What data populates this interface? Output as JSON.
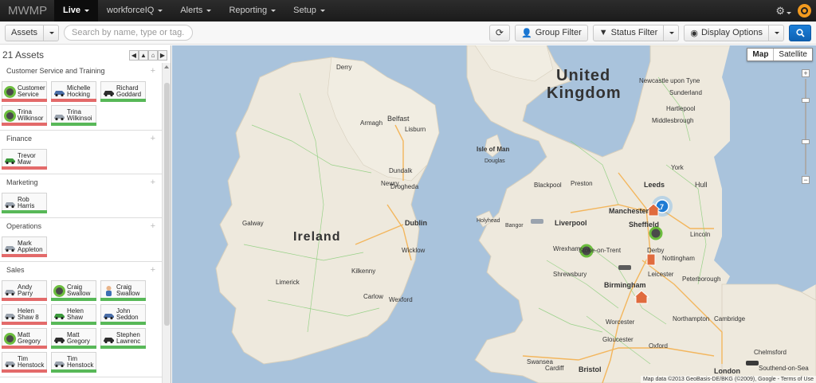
{
  "navbar": {
    "brand": "MWMP",
    "items": [
      {
        "label": "Live",
        "active": true
      },
      {
        "label": "workforceIQ",
        "active": false
      },
      {
        "label": "Alerts",
        "active": false
      },
      {
        "label": "Reporting",
        "active": false
      },
      {
        "label": "Setup",
        "active": false
      }
    ],
    "gear_icon": "gear-icon",
    "user_icon": "user-badge-icon"
  },
  "toolbar": {
    "assets_label": "Assets",
    "search_placeholder": "Search by name, type or tag...",
    "refresh_icon": "refresh-icon",
    "group_filter_label": "Group Filter",
    "status_filter_label": "Status Filter",
    "display_options_label": "Display Options",
    "search_icon": "search-icon"
  },
  "sidebar": {
    "title": "21 Assets",
    "groups": [
      {
        "name": "Customer Service and Training",
        "assets": [
          {
            "name": "Customer Service",
            "line1": "Customer",
            "line2": "Service",
            "icon": "person-dot",
            "status": "red"
          },
          {
            "name": "Michelle Hocking",
            "line1": "Michelle",
            "line2": "Hocking",
            "icon": "car-blue",
            "status": "red"
          },
          {
            "name": "Richard Goddard",
            "line1": "Richard",
            "line2": "Goddard",
            "icon": "car-black",
            "status": "green"
          },
          {
            "name": "Trina Wilkinson",
            "line1": "Trina",
            "line2": "Wilkinsor",
            "icon": "person-dot",
            "status": "red"
          },
          {
            "name": "Trina Wilkinson",
            "line1": "Trina",
            "line2": "Wilkinsoi",
            "icon": "car-silver",
            "status": "green"
          }
        ]
      },
      {
        "name": "Finance",
        "assets": [
          {
            "name": "Trevor Maw",
            "line1": "Trevor",
            "line2": "Maw",
            "icon": "car-green",
            "status": "red"
          }
        ]
      },
      {
        "name": "Marketing",
        "assets": [
          {
            "name": "Rob Harris",
            "line1": "Rob",
            "line2": "Harris",
            "icon": "car-silver",
            "status": "green"
          }
        ]
      },
      {
        "name": "Operations",
        "assets": [
          {
            "name": "Mark Appleton",
            "line1": "Mark",
            "line2": "Appleton",
            "icon": "car-silver",
            "status": "red"
          }
        ]
      },
      {
        "name": "Sales",
        "assets": [
          {
            "name": "Andy Parry",
            "line1": "Andy",
            "line2": "Parry",
            "icon": "car-silver",
            "status": "red"
          },
          {
            "name": "Craig Swallow",
            "line1": "Craig",
            "line2": "Swallow",
            "icon": "person-dot",
            "status": "green"
          },
          {
            "name": "Craig Swallow",
            "line1": "Craig",
            "line2": "Swallow",
            "icon": "person",
            "status": "green"
          },
          {
            "name": "Helen Shaw",
            "line1": "Helen",
            "line2": "Shaw 8",
            "icon": "car-silver",
            "status": "red"
          },
          {
            "name": "Helen Shaw",
            "line1": "Helen",
            "line2": "Shaw",
            "icon": "car-green",
            "status": "green"
          },
          {
            "name": "John Seddon",
            "line1": "John",
            "line2": "Seddon",
            "icon": "car-blue",
            "status": "green"
          },
          {
            "name": "Matt Gregory",
            "line1": "Matt",
            "line2": "Gregory",
            "icon": "person-dot",
            "status": "red"
          },
          {
            "name": "Matt Gregory",
            "line1": "Matt",
            "line2": "Gregory",
            "icon": "car-black",
            "status": "green"
          },
          {
            "name": "Stephen Lawrence",
            "line1": "Stephen",
            "line2": "Lawrenc",
            "icon": "car-black",
            "status": "green"
          },
          {
            "name": "Tim Henstock",
            "line1": "Tim",
            "line2": "Henstock",
            "icon": "car-silver",
            "status": "red"
          },
          {
            "name": "Tim Henstock",
            "line1": "Tim",
            "line2": "Henstock",
            "icon": "car-silver",
            "status": "green"
          }
        ]
      }
    ]
  },
  "map": {
    "type_buttons": [
      "Map",
      "Satellite"
    ],
    "selected_type": "Map",
    "zoom_in": "+",
    "zoom_out": "−",
    "cluster_count": "7",
    "countries": [
      "United",
      "Kingdom",
      "Ireland"
    ],
    "places": [
      "Belfast",
      "Dublin",
      "Isle of Man",
      "Douglas",
      "Liverpool",
      "Manchester",
      "Sheffield",
      "Leeds",
      "Hull",
      "York",
      "Newcastle upon Tyne",
      "Sunderland",
      "Middlesbrough",
      "Birmingham",
      "Leicester",
      "Nottingham",
      "Northampton",
      "Oxford",
      "London",
      "Bristol",
      "Swansea",
      "Cardiff",
      "Limerick",
      "Galway",
      "Wexford",
      "Kilkenny",
      "Derby",
      "Stoke-on-Trent",
      "Peterborough",
      "Cambridge",
      "Chelmsford",
      "Southend-on-Sea",
      "Blackpool",
      "Preston",
      "Wrexham",
      "Shrewsbury",
      "Worcester",
      "Gloucester",
      "Newry",
      "Dundalk",
      "Drogheda",
      "Armagh",
      "Lisburn",
      "Bangor",
      "Holyhead",
      "Lincoln",
      "Hartlepool",
      "Derry",
      "Carlow",
      "Wicklow"
    ],
    "copyright": "Map data ©2013 GeoBasis-DE/BKG (©2009), Google - Terms of Use"
  },
  "colors": {
    "navbar_bg": "#1b1b1b",
    "status_red": "#e36a6a",
    "status_green": "#58b858",
    "sea": "#a9c3dc",
    "land": "#eee9dd",
    "primary": "#0f62b3"
  }
}
